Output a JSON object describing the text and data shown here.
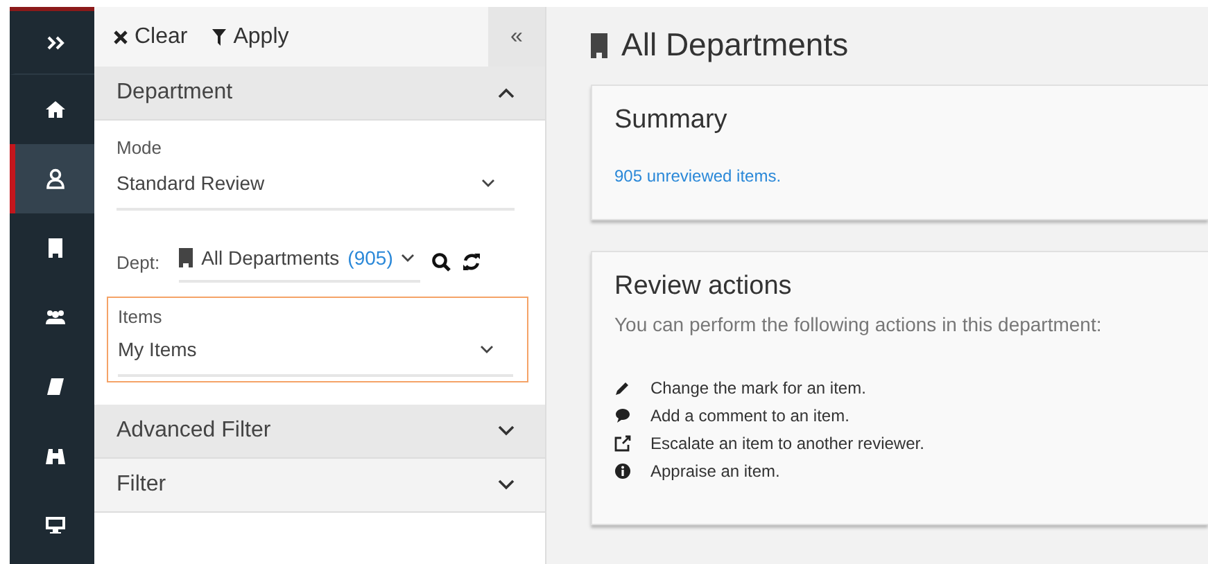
{
  "nav_rail": [
    {
      "selected": false
    },
    {
      "selected": false
    },
    {
      "selected": true
    },
    {
      "selected": false
    },
    {
      "selected": false
    },
    {
      "selected": false
    },
    {
      "selected": false
    },
    {
      "selected": false
    }
  ],
  "filter_panel": {
    "toolbar": {
      "clear": "Clear",
      "apply": "Apply",
      "collapse": "«"
    },
    "sections": [
      {
        "title": "Department",
        "expanded": true
      },
      {
        "title": "Advanced Filter",
        "expanded": false
      },
      {
        "title": "Filter",
        "expanded": false
      }
    ],
    "mode": {
      "label": "Mode",
      "value": "Standard Review"
    },
    "dept": {
      "label": "Dept:",
      "value": "All Departments",
      "count": "(905)"
    },
    "items": {
      "label": "Items",
      "value": "My Items",
      "focused": true
    }
  },
  "main": {
    "title": "All Departments",
    "summary": {
      "title": "Summary",
      "link": "905 unreviewed items."
    },
    "review_actions": {
      "title": "Review actions",
      "intro": "You can perform the following actions in this department:",
      "actions": [
        "Change the mark for an item.",
        "Add a comment to an item.",
        "Escalate an item to another reviewer.",
        "Appraise an item."
      ]
    }
  }
}
